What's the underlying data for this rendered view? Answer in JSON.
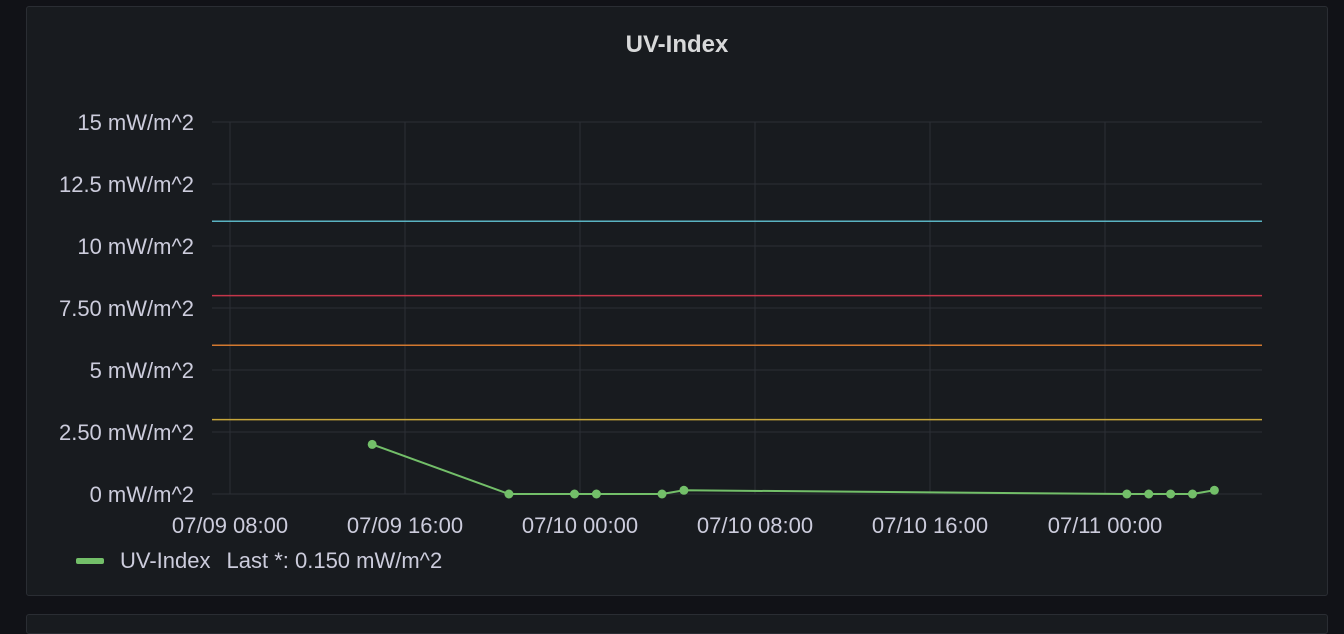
{
  "panel": {
    "title": "UV-Index"
  },
  "legend": {
    "series_name": "UV-Index",
    "value_text": "Last *: 0.150 mW/m^2"
  },
  "chart_data": {
    "type": "line",
    "title": "UV-Index",
    "xlabel": "",
    "ylabel": "",
    "unit": "mW/m^2",
    "ylim": [
      0,
      15
    ],
    "xlim": [
      "07/09 08:00",
      "07/11 20:00"
    ],
    "grid": true,
    "legend_position": "bottom-left",
    "y_ticks": [
      {
        "value": 0,
        "label": "0 mW/m^2"
      },
      {
        "value": 2.5,
        "label": "2.50 mW/m^2"
      },
      {
        "value": 5,
        "label": "5 mW/m^2"
      },
      {
        "value": 7.5,
        "label": "7.50 mW/m^2"
      },
      {
        "value": 10,
        "label": "10 mW/m^2"
      },
      {
        "value": 12.5,
        "label": "12.5 mW/m^2"
      },
      {
        "value": 15,
        "label": "15 mW/m^2"
      }
    ],
    "x_ticks": [
      "07/09 08:00",
      "07/09 16:00",
      "07/10 00:00",
      "07/10 08:00",
      "07/10 16:00",
      "07/11 00:00"
    ],
    "thresholds": [
      {
        "value": 3,
        "color": "#c8a73b"
      },
      {
        "value": 6,
        "color": "#d2782f"
      },
      {
        "value": 8,
        "color": "#c4364a"
      },
      {
        "value": 11,
        "color": "#5ab3c2"
      }
    ],
    "series": [
      {
        "name": "UV-Index",
        "color": "#73bf69",
        "points": [
          {
            "x": "07/09 14:30",
            "y": 2.0
          },
          {
            "x": "07/09 20:45",
            "y": 0
          },
          {
            "x": "07/09 23:45",
            "y": 0
          },
          {
            "x": "07/10 00:45",
            "y": 0
          },
          {
            "x": "07/10 03:45",
            "y": 0
          },
          {
            "x": "07/10 04:45",
            "y": 0.15
          },
          {
            "x": "07/11 01:00",
            "y": 0
          },
          {
            "x": "07/11 02:00",
            "y": 0
          },
          {
            "x": "07/11 03:00",
            "y": 0
          },
          {
            "x": "07/11 04:00",
            "y": 0
          },
          {
            "x": "07/11 05:00",
            "y": 0.15
          }
        ]
      }
    ]
  }
}
